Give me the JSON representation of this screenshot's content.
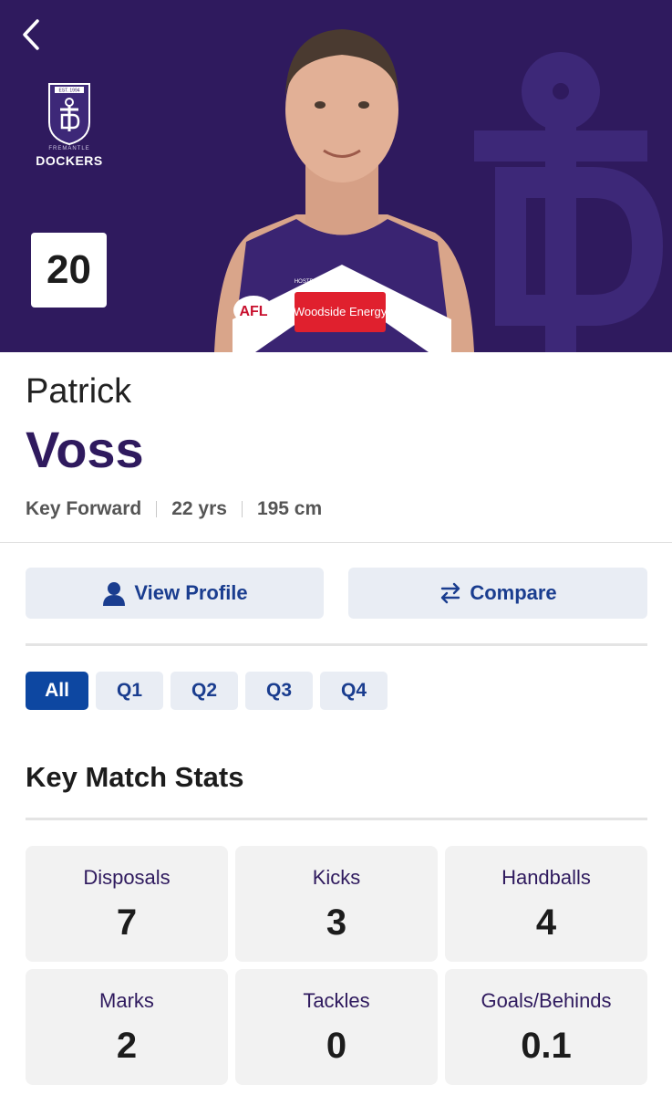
{
  "header": {
    "club_name": "DOCKERS",
    "club_subname": "FREMANTLE",
    "club_est": "EST. 1994",
    "jumper_number": "20",
    "sponsor_primary": "Woodside Energy",
    "sponsor_secondary": "HOSTPLUS",
    "league_logo": "AFL",
    "colors": {
      "club_purple": "#2f1a5e",
      "accent_blue": "#0d47a1"
    }
  },
  "player": {
    "first_name": "Patrick",
    "last_name": "Voss",
    "position": "Key Forward",
    "age": "22 yrs",
    "height": "195 cm"
  },
  "actions": {
    "view_profile": {
      "label": "View Profile",
      "icon": "person-icon"
    },
    "compare": {
      "label": "Compare",
      "icon": "swap-arrows-icon"
    }
  },
  "period_tabs": {
    "selected": "All",
    "items": [
      "All",
      "Q1",
      "Q2",
      "Q3",
      "Q4"
    ]
  },
  "stats_section": {
    "title": "Key Match Stats",
    "items": [
      {
        "label": "Disposals",
        "value": "7"
      },
      {
        "label": "Kicks",
        "value": "3"
      },
      {
        "label": "Handballs",
        "value": "4"
      },
      {
        "label": "Marks",
        "value": "2"
      },
      {
        "label": "Tackles",
        "value": "0"
      },
      {
        "label": "Goals/Behinds",
        "value": "0.1"
      }
    ]
  }
}
